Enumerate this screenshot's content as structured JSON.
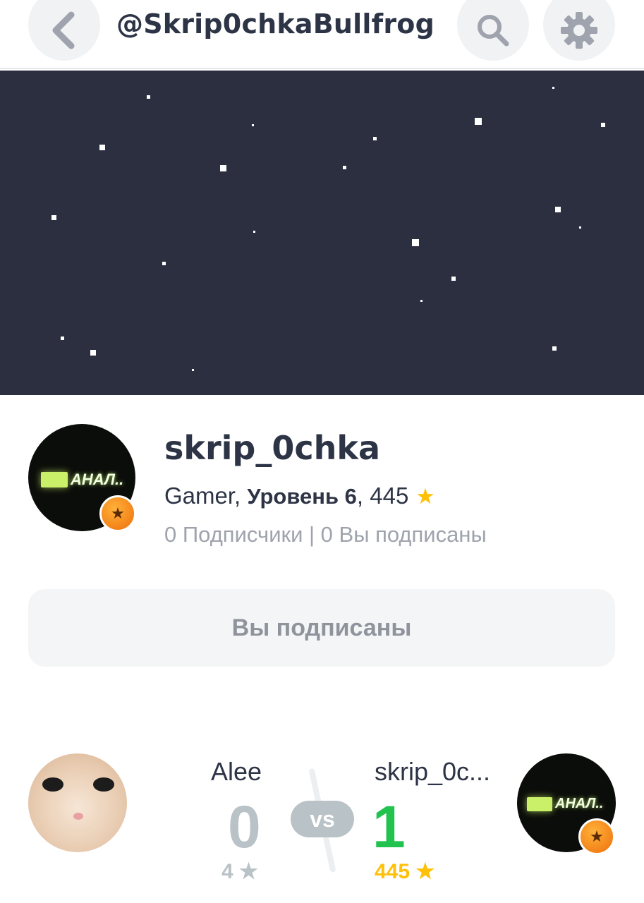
{
  "header": {
    "title": "@Skrip0chkaBullfrog"
  },
  "profile": {
    "username": "skrip_0chka",
    "role": "Gamer",
    "level_label": "Уровень 6",
    "points": "445",
    "followers": "0 Подписчики | 0 Вы подписаны",
    "avatar_sign_text": "АНАЛ.."
  },
  "actions": {
    "subscribed_label": "Вы подписаны"
  },
  "versus": {
    "left_name": "Alee",
    "left_score": "0",
    "left_points": "4",
    "vs_label": "vs",
    "right_name": "skrip_0c...",
    "right_score": "1",
    "right_points": "445",
    "right_sign_text": "АНАЛ.."
  },
  "colors": {
    "banner": "#2b2f3f",
    "text_dark": "#2d3446",
    "muted": "#9ea3ad",
    "win_green": "#22c24f",
    "star_gold": "#ffc107",
    "badge_orange": "#ee6f0a"
  },
  "icons": [
    "back-arrow-icon",
    "search-icon",
    "gear-icon",
    "star-icon"
  ]
}
